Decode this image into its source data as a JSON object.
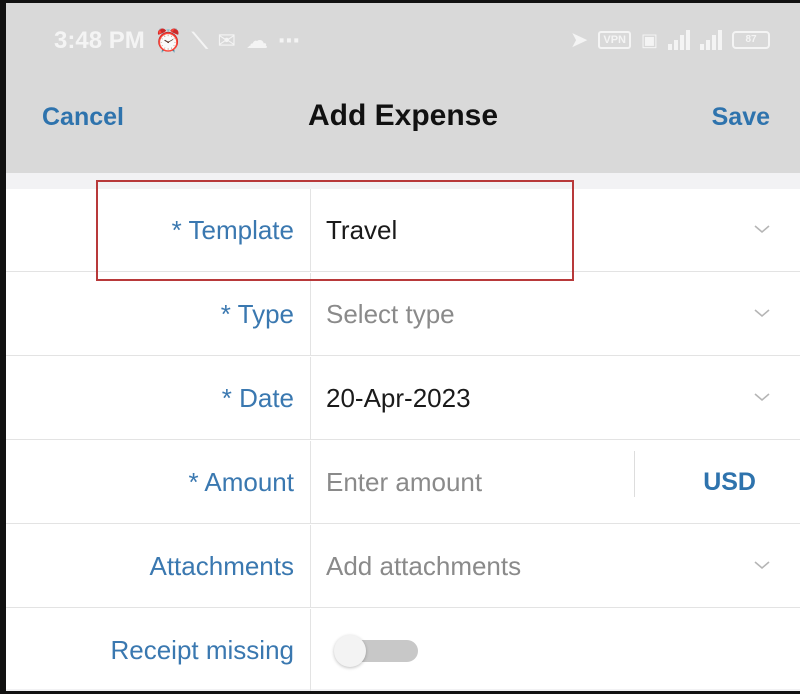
{
  "status_bar": {
    "time": "3:48 PM",
    "vpn_chip": "VPN",
    "battery": "87"
  },
  "header": {
    "cancel_label": "Cancel",
    "title": "Add Expense",
    "save_label": "Save"
  },
  "form": {
    "rows": [
      {
        "label": "* Template",
        "value": "Travel",
        "is_placeholder": false
      },
      {
        "label": "* Type",
        "value": "Select type",
        "is_placeholder": true
      },
      {
        "label": "* Date",
        "value": "20-Apr-2023",
        "is_placeholder": false
      },
      {
        "label": "* Amount",
        "value": "Enter amount",
        "is_placeholder": true,
        "currency": "USD"
      },
      {
        "label": "Attachments",
        "value": "Add attachments",
        "is_placeholder": true
      },
      {
        "label": "Receipt missing",
        "toggle_on": false
      }
    ]
  },
  "colors": {
    "accent": "#2e73ad",
    "label": "#3a78b0",
    "highlight": "#b8393a",
    "header_bg": "#d9d9d9"
  }
}
